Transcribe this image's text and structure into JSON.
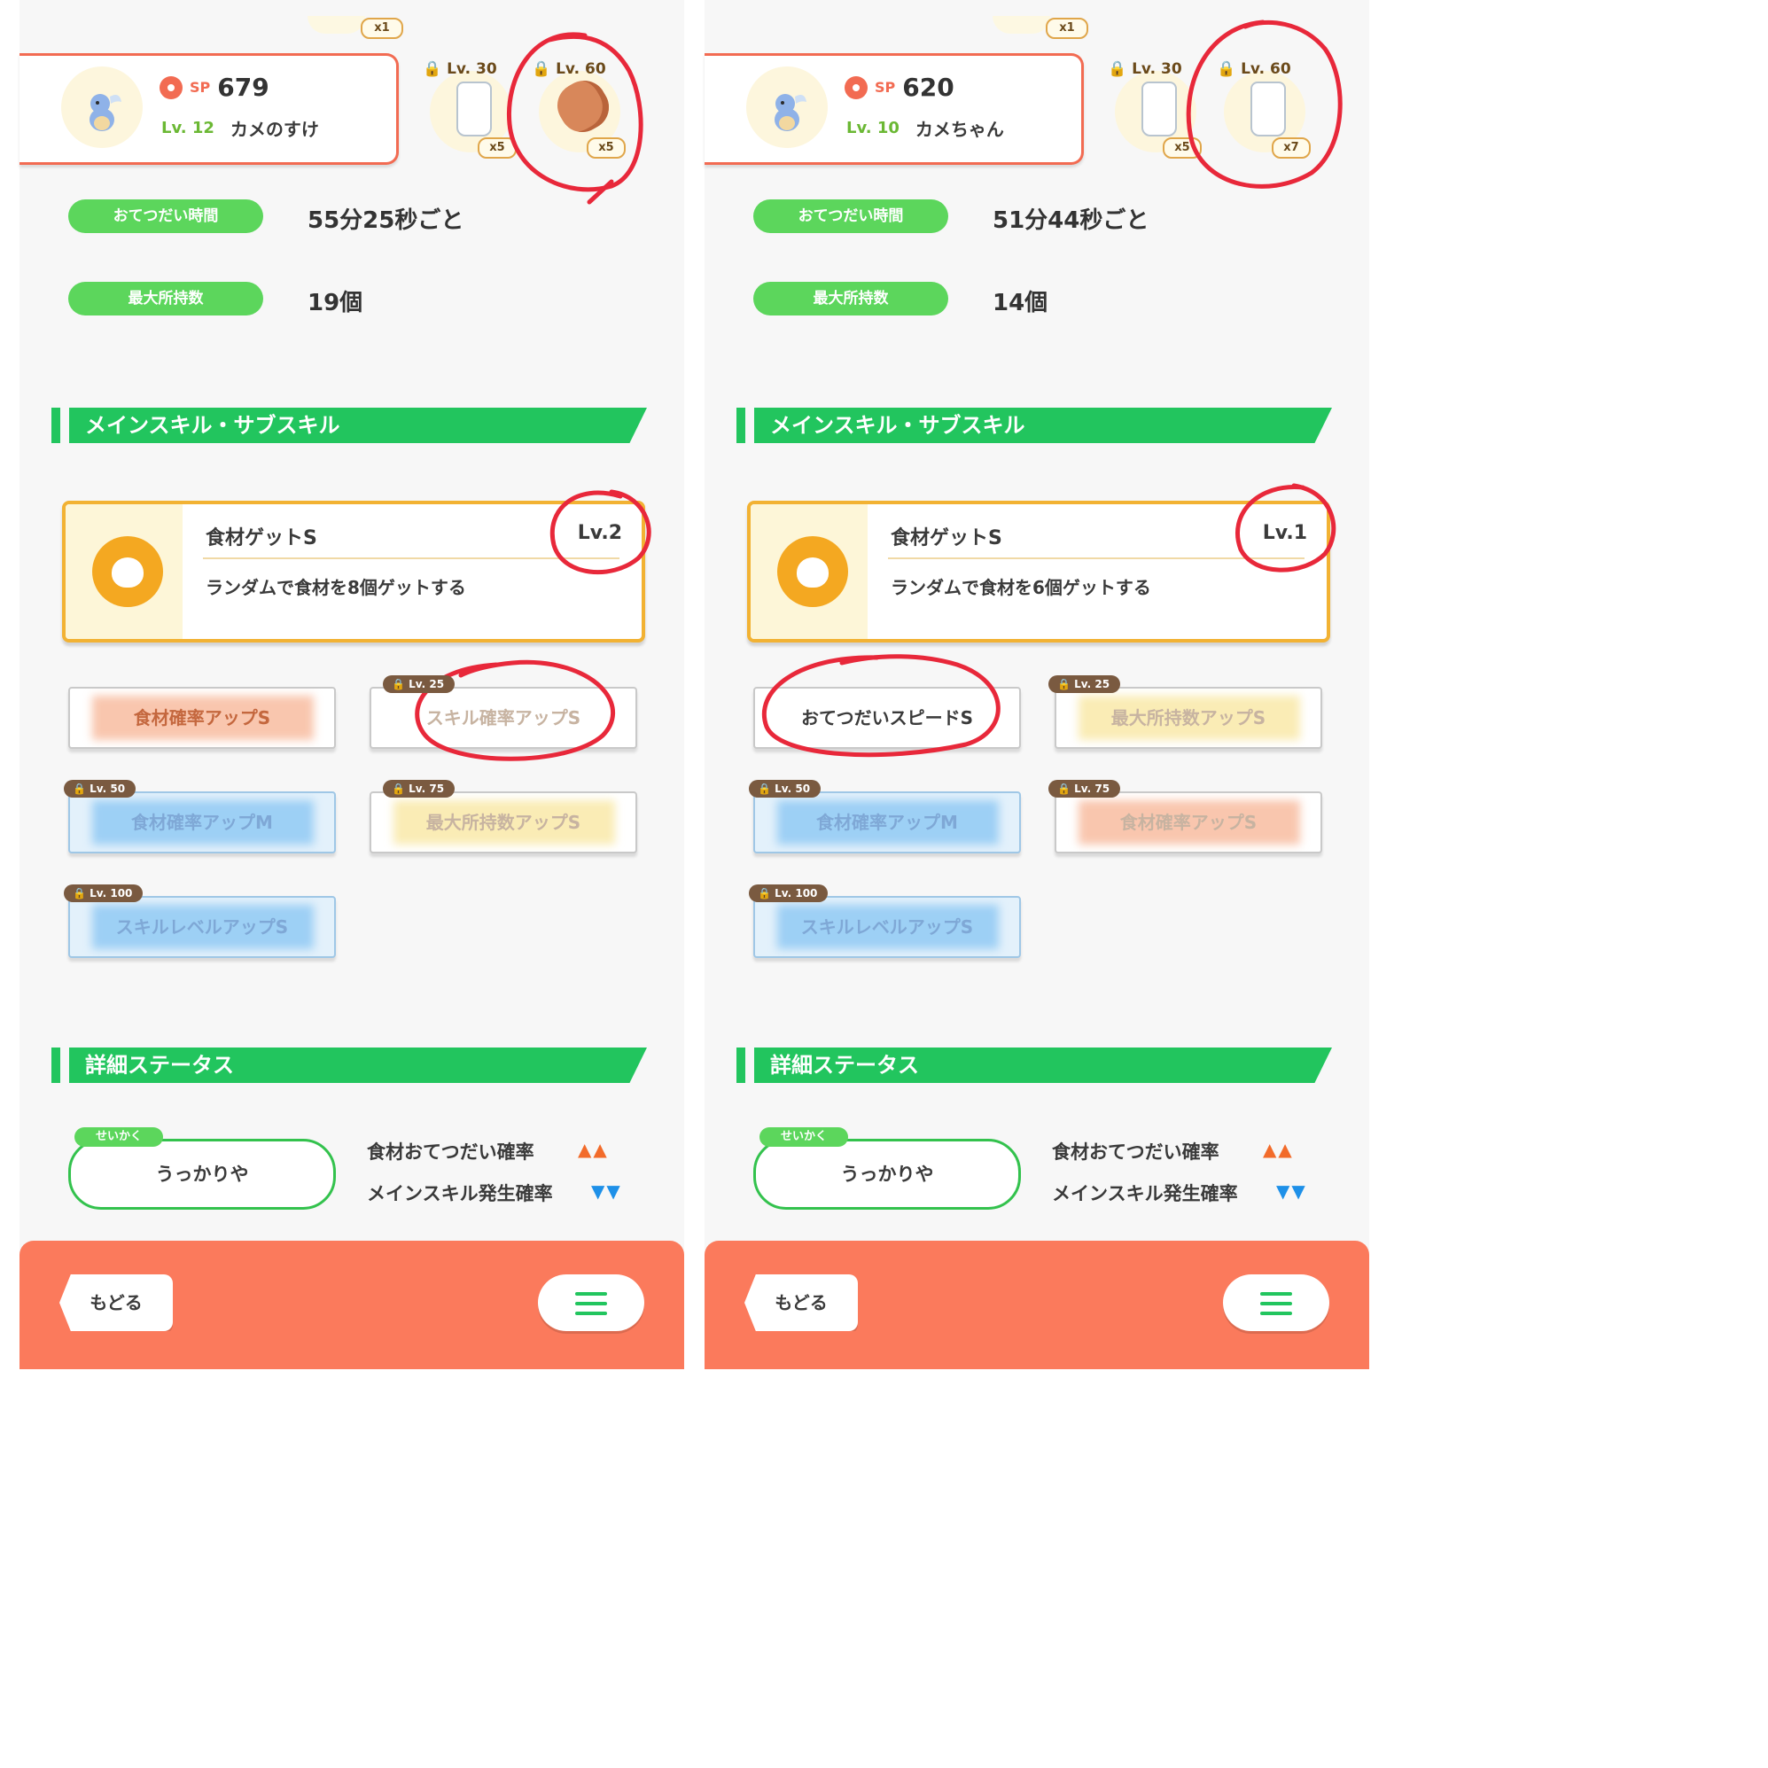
{
  "left": {
    "top_count": "x1",
    "sp_label": "SP",
    "sp_value": "679",
    "level": "Lv. 12",
    "name": "カメのすけ",
    "ing1_lv": "Lv. 30",
    "ing1_count": "x5",
    "ing2_lv": "Lv. 60",
    "ing2_count": "x5",
    "stats": [
      {
        "label": "おてつだい時間",
        "value": "55分25秒ごと"
      },
      {
        "label": "最大所持数",
        "value": "19個"
      }
    ],
    "section_skill": "メインスキル・サブスキル",
    "main_skill": {
      "name": "食材ゲットS",
      "level": "Lv.2",
      "desc": "ランダムで食材を8個ゲットする"
    },
    "subskills": [
      {
        "label": "食材確率アップS",
        "lock": ""
      },
      {
        "label": "スキル確率アップS",
        "lock": "Lv. 25"
      },
      {
        "label": "食材確率アップM",
        "lock": "Lv. 50"
      },
      {
        "label": "最大所持数アップS",
        "lock": "Lv. 75"
      },
      {
        "label": "スキルレベルアップS",
        "lock": "Lv. 100"
      }
    ],
    "section_status": "詳細ステータス",
    "nature_tag": "せいかく",
    "nature": "うっかりや",
    "nature_up": "食材おてつだい確率",
    "nature_down": "メインスキル発生確率",
    "up_arrows": "▲▲",
    "down_arrows": "▼▼",
    "back": "もどる"
  },
  "right": {
    "top_count": "x1",
    "sp_label": "SP",
    "sp_value": "620",
    "level": "Lv. 10",
    "name": "カメちゃん",
    "ing1_lv": "Lv. 30",
    "ing1_count": "x5",
    "ing2_lv": "Lv. 60",
    "ing2_count": "x7",
    "stats": [
      {
        "label": "おてつだい時間",
        "value": "51分44秒ごと"
      },
      {
        "label": "最大所持数",
        "value": "14個"
      }
    ],
    "section_skill": "メインスキル・サブスキル",
    "main_skill": {
      "name": "食材ゲットS",
      "level": "Lv.1",
      "desc": "ランダムで食材を6個ゲットする"
    },
    "subskills": [
      {
        "label": "おてつだいスピードS",
        "lock": ""
      },
      {
        "label": "最大所持数アップS",
        "lock": "Lv. 25"
      },
      {
        "label": "食材確率アップM",
        "lock": "Lv. 50"
      },
      {
        "label": "食材確率アップS",
        "lock": "Lv. 75"
      },
      {
        "label": "スキルレベルアップS",
        "lock": "Lv. 100"
      }
    ],
    "section_status": "詳細ステータス",
    "nature_tag": "せいかく",
    "nature": "うっかりや",
    "nature_up": "食材おてつだい確率",
    "nature_down": "メインスキル発生確率",
    "up_arrows": "▲▲",
    "down_arrows": "▼▼",
    "back": "もどる"
  },
  "colors": {
    "accent_green": "#22c55e",
    "pill_green": "#5cd65c",
    "footer_coral": "#fb7a5c",
    "skill_gold": "#f2b233",
    "annotation_red": "#e8283a"
  },
  "icons": [
    "wartortle-avatar-icon",
    "sp-ball-icon",
    "milk-bottle-icon",
    "cacao-bean-icon",
    "apple-icon",
    "lock-icon",
    "hamburger-menu-icon",
    "back-arrow-icon"
  ]
}
